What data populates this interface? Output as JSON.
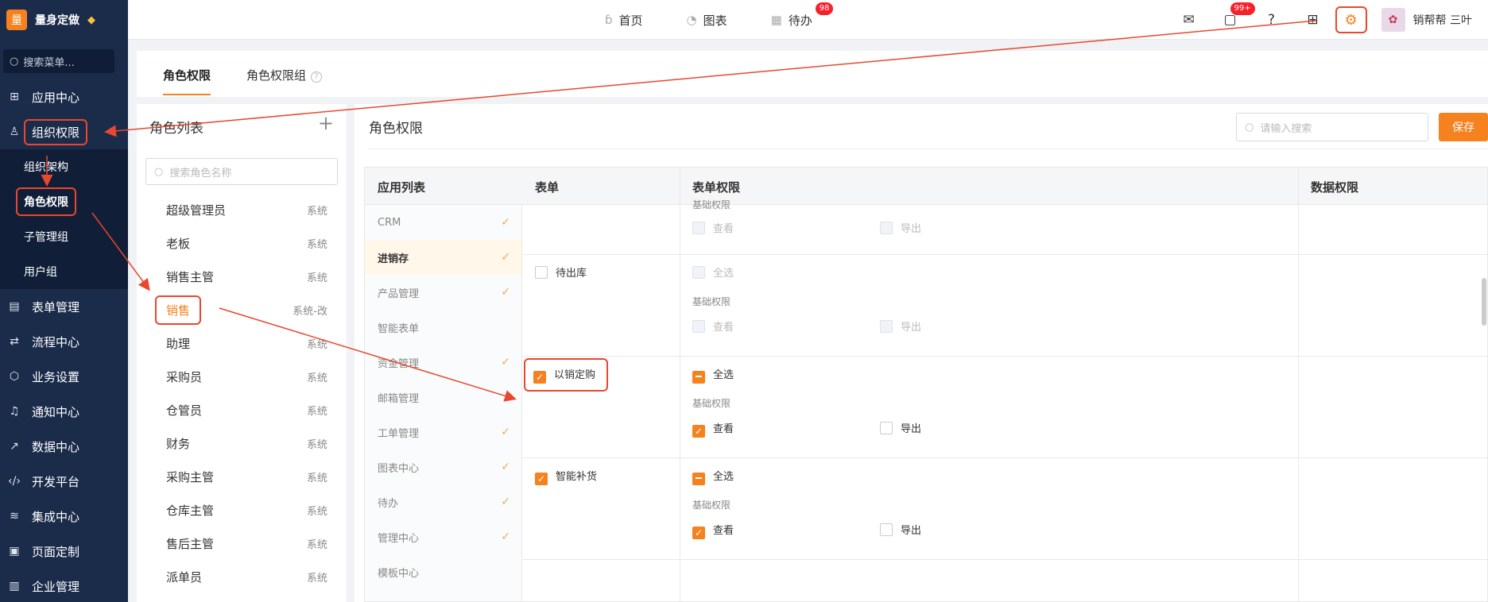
{
  "brand": {
    "logo": "量",
    "name": "量身定做"
  },
  "sidebar": {
    "search_placeholder": "搜索菜单...",
    "items": [
      {
        "label": "应用中心",
        "icon": "apps-icon"
      },
      {
        "label": "组织权限",
        "icon": "user-icon"
      },
      {
        "label": "表单管理",
        "icon": "form-icon"
      },
      {
        "label": "流程中心",
        "icon": "flow-icon"
      },
      {
        "label": "业务设置",
        "icon": "cube-icon"
      },
      {
        "label": "通知中心",
        "icon": "bell-icon"
      },
      {
        "label": "数据中心",
        "icon": "chart-icon"
      },
      {
        "label": "开发平台",
        "icon": "code-icon"
      },
      {
        "label": "集成中心",
        "icon": "layers-icon"
      },
      {
        "label": "页面定制",
        "icon": "layout-icon"
      },
      {
        "label": "企业管理",
        "icon": "building-icon"
      }
    ],
    "subitems": [
      "组织架构",
      "角色权限",
      "子管理组",
      "用户组"
    ]
  },
  "topnav": {
    "home": "首页",
    "charts": "图表",
    "todo": "待办",
    "todo_badge": "98",
    "msg_badge": "99+",
    "user": "销帮帮 三叶"
  },
  "tabs": {
    "role_perm": "角色权限",
    "role_group": "角色权限组",
    "help": "?"
  },
  "role_panel": {
    "title": "角色列表",
    "add": "+",
    "search_placeholder": "搜索角色名称",
    "roles": [
      {
        "name": "超级管理员",
        "tag": "系统"
      },
      {
        "name": "老板",
        "tag": "系统"
      },
      {
        "name": "销售主管",
        "tag": "系统"
      },
      {
        "name": "销售",
        "tag": "系统-改"
      },
      {
        "name": "助理",
        "tag": "系统"
      },
      {
        "name": "采购员",
        "tag": "系统"
      },
      {
        "name": "仓管员",
        "tag": "系统"
      },
      {
        "name": "财务",
        "tag": "系统"
      },
      {
        "name": "采购主管",
        "tag": "系统"
      },
      {
        "name": "仓库主管",
        "tag": "系统"
      },
      {
        "name": "售后主管",
        "tag": "系统"
      },
      {
        "name": "派单员",
        "tag": "系统"
      }
    ]
  },
  "main": {
    "title": "角色权限",
    "search_placeholder": "请输入搜索",
    "save": "保存",
    "headers": {
      "apps": "应用列表",
      "form": "表单",
      "form_perm": "表单权限",
      "data_perm": "数据权限"
    },
    "apps": [
      {
        "name": "CRM",
        "checked": true
      },
      {
        "name": "进销存",
        "checked": true
      },
      {
        "name": "产品管理",
        "checked": true
      },
      {
        "name": "智能表单",
        "checked": false
      },
      {
        "name": "资金管理",
        "checked": true
      },
      {
        "name": "邮箱管理",
        "checked": false
      },
      {
        "name": "工单管理",
        "checked": true
      },
      {
        "name": "图表中心",
        "checked": true
      },
      {
        "name": "待办",
        "checked": true
      },
      {
        "name": "管理中心",
        "checked": true
      },
      {
        "name": "模板中心",
        "checked": false
      }
    ],
    "check_mark": "✓",
    "base_label": "基础权限",
    "select_all": "全选",
    "view": "查看",
    "export": "导出",
    "forms": [
      {
        "name": "待出库"
      },
      {
        "name": "以销定购"
      },
      {
        "name": "智能补货"
      }
    ]
  },
  "colors": {
    "accent": "#f5821f",
    "sidebar": "#1b2c4b",
    "annotation": "#e8482e"
  }
}
